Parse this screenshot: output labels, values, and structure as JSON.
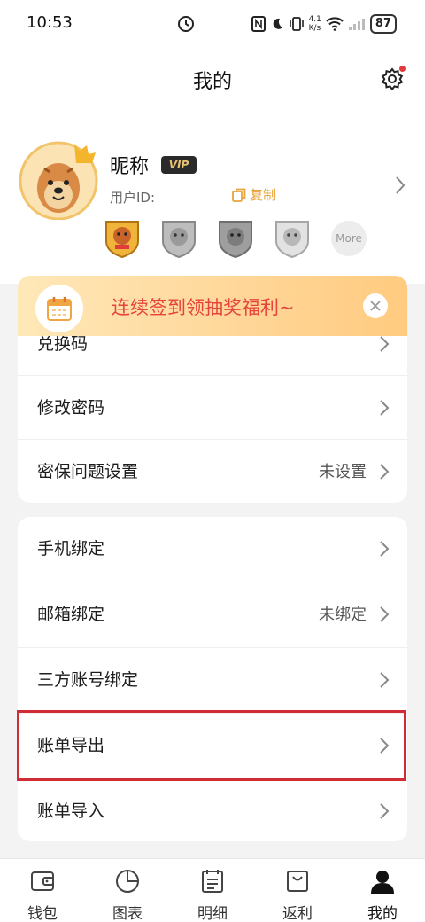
{
  "status_bar": {
    "time": "10:53",
    "speed": "4.1\nK/s",
    "battery": "87"
  },
  "header": {
    "title": "我的"
  },
  "profile": {
    "nickname": "昵称",
    "vip": "VIP",
    "user_id_label": "用户ID:",
    "copy_label": "复制",
    "more_label": "More"
  },
  "signin_banner": {
    "text": "连续签到领抽奖福利~"
  },
  "settings_group1": [
    {
      "label": "兑换码",
      "value": ""
    },
    {
      "label": "修改密码",
      "value": ""
    },
    {
      "label": "密保问题设置",
      "value": "未设置"
    }
  ],
  "settings_group2": [
    {
      "label": "手机绑定",
      "value": ""
    },
    {
      "label": "邮箱绑定",
      "value": "未绑定"
    },
    {
      "label": "三方账号绑定",
      "value": ""
    },
    {
      "label": "账单导出",
      "value": ""
    },
    {
      "label": "账单导入",
      "value": ""
    }
  ],
  "tabs": [
    {
      "label": "钱包",
      "icon": "wallet-icon"
    },
    {
      "label": "图表",
      "icon": "pie-chart-icon"
    },
    {
      "label": "明细",
      "icon": "list-icon"
    },
    {
      "label": "返利",
      "icon": "bag-icon"
    },
    {
      "label": "我的",
      "icon": "person-icon"
    }
  ],
  "colors": {
    "accent": "#e8a33c",
    "banner_text": "#e6433b",
    "highlight": "#d12b35"
  }
}
